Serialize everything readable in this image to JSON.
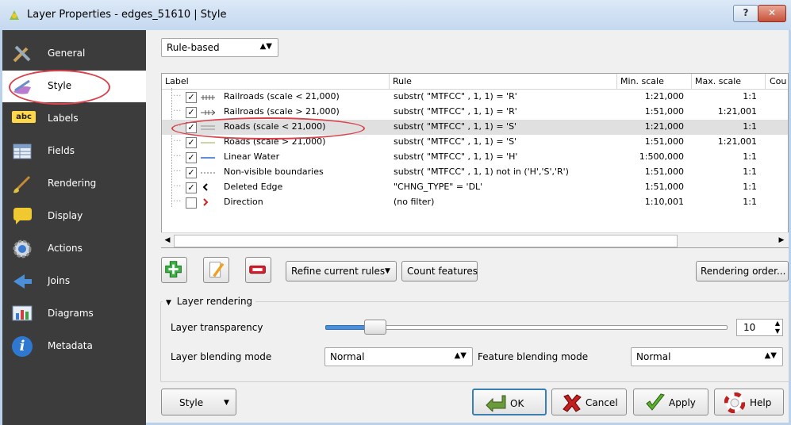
{
  "window": {
    "title": "Layer Properties - edges_51610 | Style",
    "help_label": "?",
    "close_label": "✕"
  },
  "sidebar": {
    "items": [
      {
        "label": "General",
        "icon": "tools-icon"
      },
      {
        "label": "Style",
        "icon": "brush-icon"
      },
      {
        "label": "Labels",
        "icon": "labels-icon",
        "badge": "abc"
      },
      {
        "label": "Fields",
        "icon": "table-icon"
      },
      {
        "label": "Rendering",
        "icon": "paintbrush-icon"
      },
      {
        "label": "Display",
        "icon": "speech-bubble-icon"
      },
      {
        "label": "Actions",
        "icon": "gear-icon"
      },
      {
        "label": "Joins",
        "icon": "join-arrow-icon"
      },
      {
        "label": "Diagrams",
        "icon": "chart-icon"
      },
      {
        "label": "Metadata",
        "icon": "info-icon",
        "glyph": "i"
      }
    ]
  },
  "renderer": {
    "selected": "Rule-based"
  },
  "table": {
    "headers": [
      "Label",
      "Rule",
      "Min. scale",
      "Max. scale",
      "Cou"
    ],
    "rows": [
      {
        "checked": true,
        "label": "Railroads (scale < 21,000)",
        "rule": "substr( \"MTFCC\" , 1, 1) = 'R'",
        "min": "1:21,000",
        "max": "1:1",
        "symbol": "railroad"
      },
      {
        "checked": true,
        "label": "Railroads (scale > 21,000)",
        "rule": "substr( \"MTFCC\" , 1, 1) = 'R'",
        "min": "1:51,000",
        "max": "1:21,001",
        "symbol": "railroad-arrow"
      },
      {
        "checked": true,
        "label": "Roads (scale < 21,000)",
        "rule": "substr( \"MTFCC\" , 1, 1) = 'S'",
        "min": "1:21,000",
        "max": "1:1",
        "symbol": "road-double"
      },
      {
        "checked": true,
        "label": "Roads (scale > 21,000)",
        "rule": "substr( \"MTFCC\" , 1, 1) = 'S'",
        "min": "1:51,000",
        "max": "1:21,001",
        "symbol": "road-single"
      },
      {
        "checked": true,
        "label": "Linear Water",
        "rule": "substr( \"MTFCC\" , 1, 1) = 'H'",
        "min": "1:500,000",
        "max": "1:1",
        "symbol": "water"
      },
      {
        "checked": true,
        "label": "Non-visible boundaries",
        "rule": "substr( \"MTFCC\" , 1, 1) not in ('H','S','R')",
        "min": "1:51,000",
        "max": "1:1",
        "symbol": "dashed"
      },
      {
        "checked": true,
        "label": "Deleted Edge",
        "rule": "\"CHNG_TYPE\" = 'DL'",
        "min": "1:51,000",
        "max": "1:1",
        "symbol": "chevron-left"
      },
      {
        "checked": false,
        "label": "Direction",
        "rule": "(no filter)",
        "min": "1:10,001",
        "max": "1:1",
        "symbol": "chevron-right"
      }
    ]
  },
  "buttons": {
    "refine": "Refine current rules",
    "count": "Count features",
    "rendering_order": "Rendering order...",
    "style": "Style",
    "ok": "OK",
    "cancel": "Cancel",
    "apply": "Apply",
    "help": "Help"
  },
  "layer_rendering": {
    "title": "Layer rendering",
    "transparency_label": "Layer transparency",
    "transparency_value": "10",
    "blending_label": "Layer blending mode",
    "blending_value": "Normal",
    "feature_blending_label": "Feature blending mode",
    "feature_blending_value": "Normal"
  },
  "colors": {
    "highlight_circle": "#d9414b",
    "sidebar_bg": "#3c3c3c",
    "accent_blue": "#4a8fd8"
  }
}
